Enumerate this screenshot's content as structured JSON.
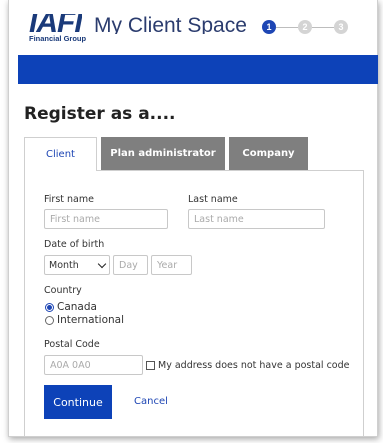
{
  "header": {
    "logo_mark": "IAFI",
    "logo_sub": "Financial Group",
    "app_title": "My Client Space",
    "steps": [
      "1",
      "2",
      "3"
    ],
    "active_step": 1
  },
  "page_title": "Register as a....",
  "tabs": [
    {
      "label": "Client",
      "active": true
    },
    {
      "label": "Plan administrator",
      "active": false
    },
    {
      "label": "Company",
      "active": false
    }
  ],
  "form": {
    "first_name_label": "First name",
    "first_name_placeholder": "First name",
    "last_name_label": "Last name",
    "last_name_placeholder": "Last name",
    "dob_label": "Date of birth",
    "month_value": "Month",
    "day_placeholder": "Day",
    "year_placeholder": "Year",
    "country_label": "Country",
    "country_options": [
      {
        "label": "Canada",
        "checked": true
      },
      {
        "label": "International",
        "checked": false
      }
    ],
    "postal_label": "Postal Code",
    "postal_placeholder": "A0A 0A0",
    "no_postal_label": "My address does not have a postal code"
  },
  "actions": {
    "continue_label": "Continue",
    "cancel_label": "Cancel"
  },
  "colors": {
    "brand_blue": "#0d42b8",
    "tab_inactive": "#7f7f7f"
  }
}
